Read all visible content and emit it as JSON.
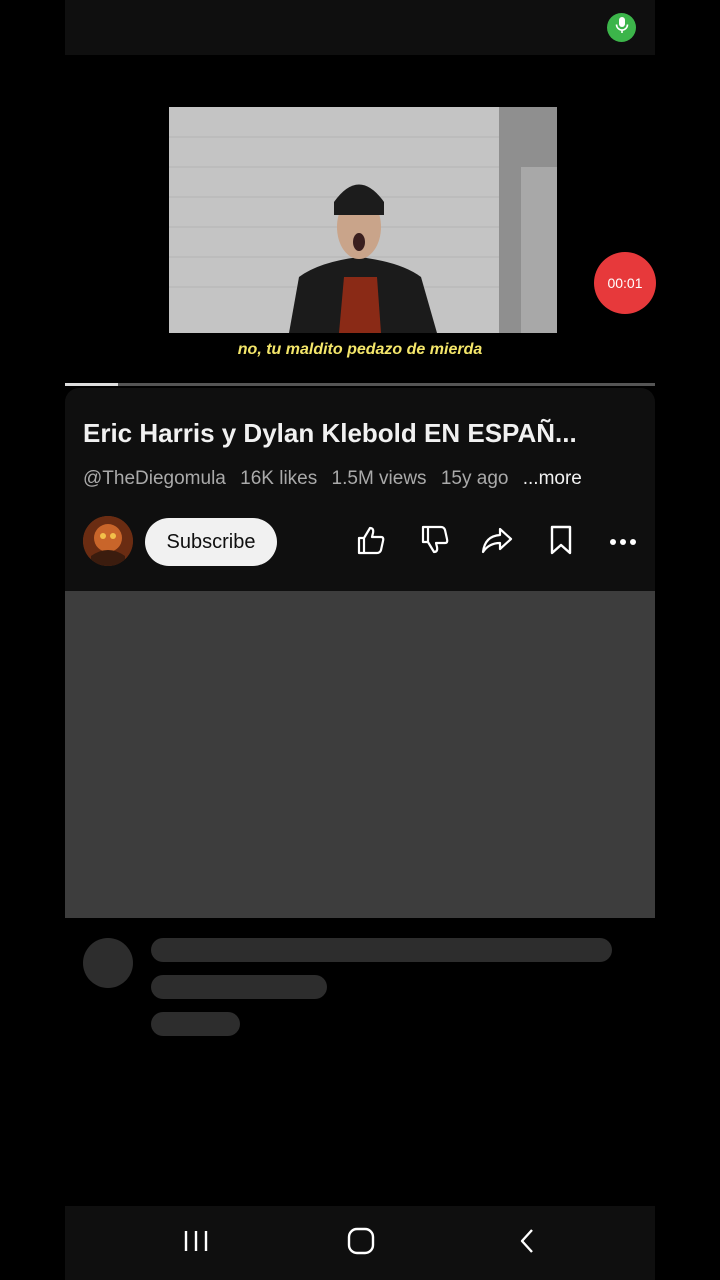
{
  "recording": {
    "timer": "00:01"
  },
  "player": {
    "subtitle": "no, tu maldito pedazo de mierda",
    "progress_fraction": 0.09
  },
  "video": {
    "title": "Eric Harris y Dylan Klebold EN ESPAÑ...",
    "channel": "@TheDiegomula",
    "likes": "16K likes",
    "views": "1.5M views",
    "age": "15y ago",
    "more_label": "...more",
    "subscribe_label": "Subscribe"
  },
  "icons": {
    "mic": "mic-icon",
    "like": "thumbs-up-icon",
    "dislike": "thumbs-down-icon",
    "share": "share-icon",
    "save": "bookmark-icon",
    "more": "more-icon",
    "nav_recent": "recent-apps-icon",
    "nav_home": "home-icon",
    "nav_back": "back-icon"
  },
  "colors": {
    "mic_badge": "#3cb54a",
    "timer_badge": "#e7393b",
    "subtitle": "#f4e66a"
  }
}
